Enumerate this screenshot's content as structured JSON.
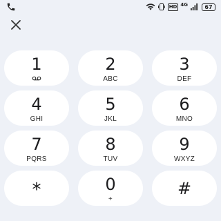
{
  "status_bar": {
    "network_type": "4G",
    "hd_label": "HD",
    "battery": "67",
    "icons": [
      "phone-icon",
      "wifi-icon",
      "vibrate-icon",
      "signal-icon"
    ]
  },
  "header": {
    "close_icon": "close-icon"
  },
  "keypad": {
    "keys": [
      {
        "digit": "1",
        "letters": "",
        "icon": "voicemail-icon"
      },
      {
        "digit": "2",
        "letters": "ABC"
      },
      {
        "digit": "3",
        "letters": "DEF"
      },
      {
        "digit": "4",
        "letters": "GHI"
      },
      {
        "digit": "5",
        "letters": "JKL"
      },
      {
        "digit": "6",
        "letters": "MNO"
      },
      {
        "digit": "7",
        "letters": "PQRS"
      },
      {
        "digit": "8",
        "letters": "TUV"
      },
      {
        "digit": "9",
        "letters": "WXYZ"
      },
      {
        "digit": "*",
        "letters": ""
      },
      {
        "digit": "0",
        "letters": "+"
      },
      {
        "digit": "#",
        "letters": ""
      }
    ]
  }
}
